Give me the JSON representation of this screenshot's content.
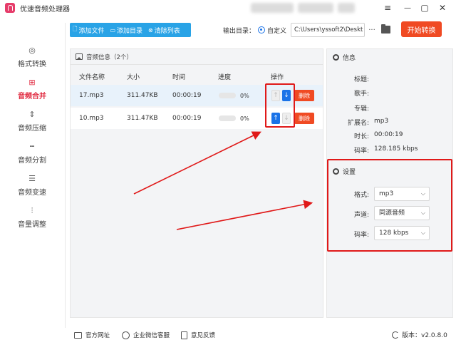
{
  "app": {
    "title": "优速音频处理器"
  },
  "window": {
    "menu_icon": "≡",
    "minimize_icon": "—",
    "maximize_icon": "▢",
    "close_icon": "✕"
  },
  "sidebar": {
    "items": [
      {
        "label": "格式转换",
        "icon": "format-convert-icon"
      },
      {
        "label": "音频合并",
        "icon": "audio-merge-icon",
        "active": true
      },
      {
        "label": "音频压缩",
        "icon": "audio-compress-icon"
      },
      {
        "label": "音频分割",
        "icon": "audio-split-icon"
      },
      {
        "label": "音频变速",
        "icon": "audio-speed-icon"
      },
      {
        "label": "音量调整",
        "icon": "volume-adjust-icon"
      }
    ]
  },
  "toolbar": {
    "add_file": "添加文件",
    "add_dir": "添加目录",
    "clear_list": "清除列表",
    "output_label": "输出目录：",
    "custom_label": "自定义",
    "output_path": "C:\\Users\\yssoft2\\Deskt",
    "browse_label": "···",
    "start_label": "开始转换"
  },
  "file_panel": {
    "title": "音频信息（2个）",
    "columns": [
      "文件名称",
      "大小",
      "时间",
      "进度",
      "操作"
    ],
    "rows": [
      {
        "name": "17.mp3",
        "size": "311.47KB",
        "time": "00:00:19",
        "progress": "0%",
        "delete": "删除"
      },
      {
        "name": "10.mp3",
        "size": "311.47KB",
        "time": "00:00:19",
        "progress": "0%",
        "delete": "删除"
      }
    ]
  },
  "info_panel": {
    "title": "信息",
    "fields": [
      {
        "label": "标题:",
        "value": ""
      },
      {
        "label": "歌手:",
        "value": ""
      },
      {
        "label": "专辑:",
        "value": ""
      },
      {
        "label": "扩展名:",
        "value": "mp3"
      },
      {
        "label": "时长:",
        "value": "00:00:19"
      },
      {
        "label": "码率:",
        "value": "128.185 kbps"
      }
    ]
  },
  "settings_panel": {
    "title": "设置",
    "fields": [
      {
        "label": "格式:",
        "value": "mp3"
      },
      {
        "label": "声道:",
        "value": "同源音频"
      },
      {
        "label": "码率:",
        "value": "128 kbps"
      }
    ]
  },
  "footer": {
    "website": "官方网址",
    "wechat": "企业微信客服",
    "feedback": "意见反馈",
    "version": "版本：v2.0.8.0"
  },
  "colors": {
    "accent_red": "#e0283e",
    "toolbar_blue": "#29a3e6",
    "start_orange": "#f04a23",
    "annotation_red": "#e01919"
  }
}
